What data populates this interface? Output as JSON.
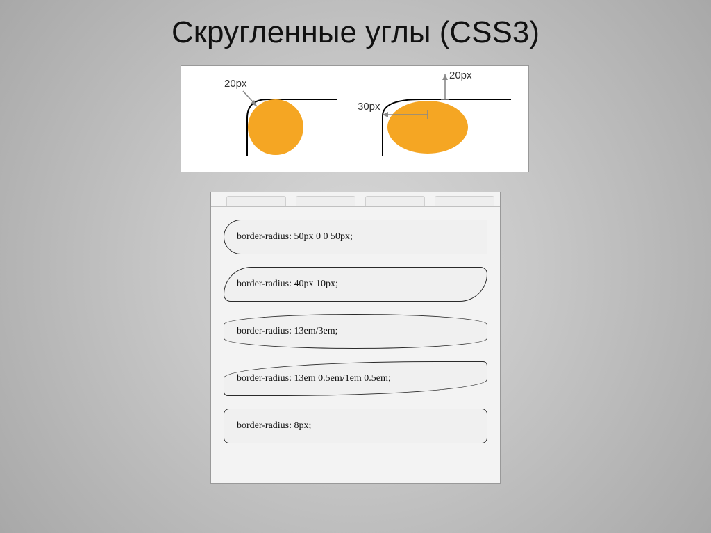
{
  "title": "Скругленные углы (CSS3)",
  "diagram": {
    "label_left": "20px",
    "label_right_top": "20px",
    "label_right_left": "30px"
  },
  "examples": [
    {
      "code": "border-radius: 50px 0 0 50px;"
    },
    {
      "code": "border-radius: 40px 10px;"
    },
    {
      "code": "border-radius: 13em/3em;"
    },
    {
      "code": "border-radius: 13em 0.5em/1em 0.5em;"
    },
    {
      "code": "border-radius: 8px;"
    }
  ]
}
